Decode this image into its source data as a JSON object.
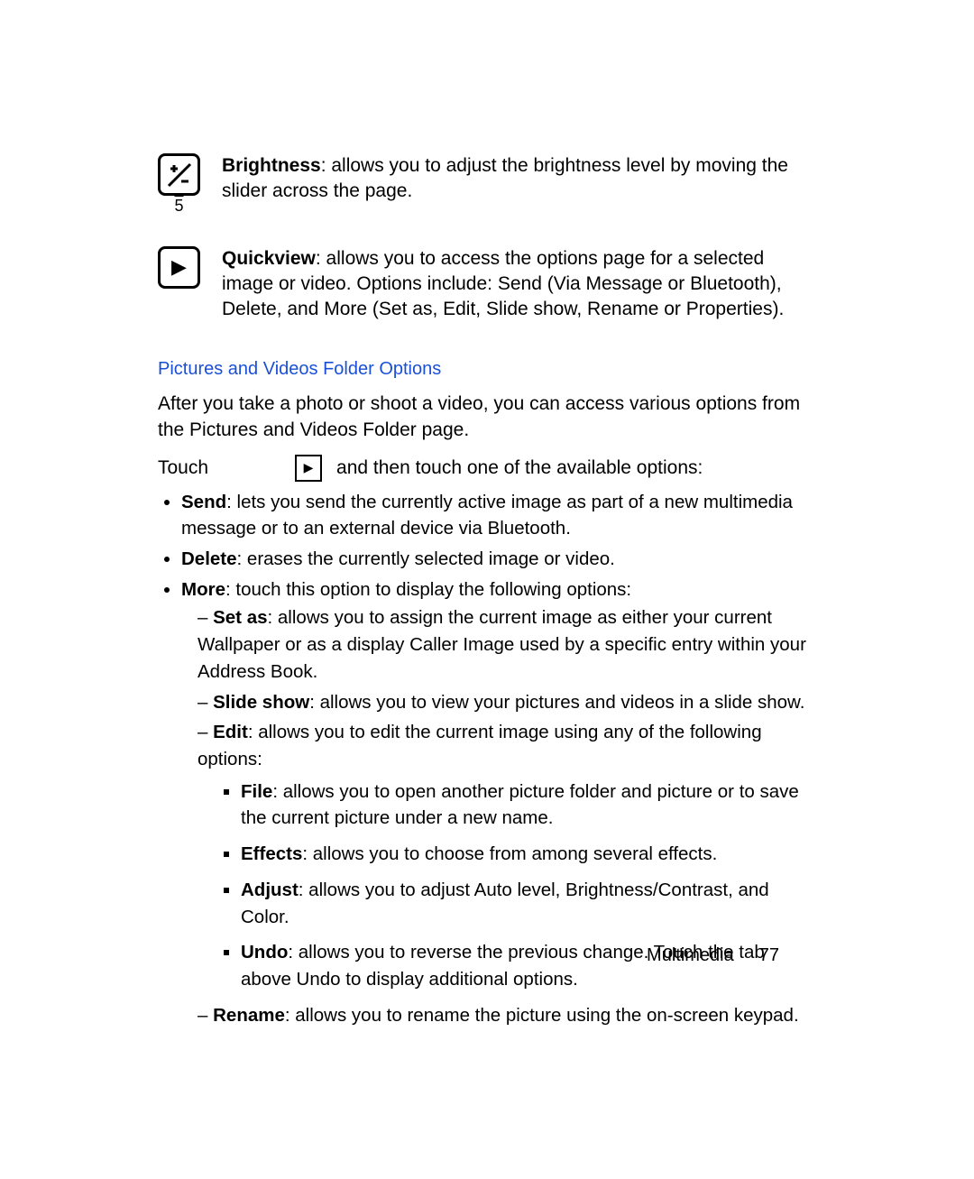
{
  "icons": {
    "brightness": {
      "label_bold": "Brightness",
      "label_rest": ": allows you to adjust the brightness level by moving the slider across the page.",
      "subscript": "5"
    },
    "quickview": {
      "label_bold": "Quickview",
      "label_rest": ": allows you to access the options page for a selected image or video. Options include: Send (Via Message or Bluetooth), Delete, and More (Set as, Edit, Slide show, Rename or Properties)."
    }
  },
  "section": {
    "heading": "Pictures and Videos Folder Options",
    "intro": "After you take a photo or shoot a video, you can access various options from the Pictures and Videos Folder page.",
    "touch_before": "Touch",
    "touch_after": "and then touch one of the available options:"
  },
  "options": {
    "send_bold": "Send",
    "send_rest": ": lets you send the currently active image as part of a new multimedia message or to an external device via Bluetooth.",
    "delete_bold": "Delete",
    "delete_rest": ": erases the currently selected image or video.",
    "more_bold": "More",
    "more_rest": ": touch this option to display the following options:",
    "setas_bold": "Set as",
    "setas_rest": ": allows you to assign the current image as either your current Wallpaper or as a display Caller Image used by a specific entry within your Address Book.",
    "slideshow_bold": "Slide show",
    "slideshow_rest": ": allows you to view your pictures and videos in a slide show.",
    "edit_bold": "Edit",
    "edit_rest": ": allows you to edit the current image using any of the following options:",
    "file_bold": "File",
    "file_rest": ": allows you to open another picture folder and picture or to save the current picture under a new name.",
    "effects_bold": "Effects",
    "effects_rest": ": allows you to choose from among several effects.",
    "adjust_bold": "Adjust",
    "adjust_rest": ": allows you to adjust Auto level, Brightness/Contrast, and Color.",
    "undo_bold": "Undo",
    "undo_rest": ": allows you to reverse the previous change. Touch the tab above Undo to display additional options.",
    "rename_bold": "Rename",
    "rename_rest": ": allows you to rename the picture using the on-screen keypad."
  },
  "footer": {
    "section": "Multimedia",
    "page": "77"
  }
}
